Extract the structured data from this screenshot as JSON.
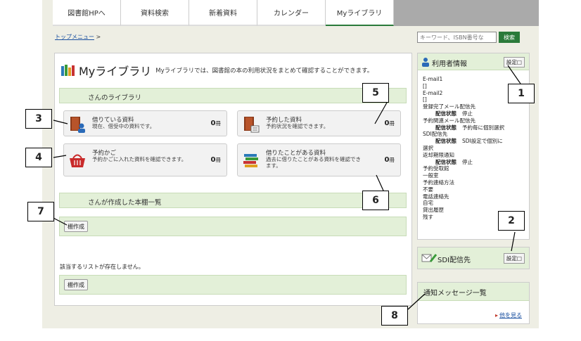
{
  "nav": {
    "tabs": [
      "図書館HPへ",
      "資料検索",
      "新着資料",
      "カレンダー",
      "Myライブラリ"
    ],
    "active_tab": 4
  },
  "breadcrumb": {
    "link": "トップメニュー",
    "separator": ">"
  },
  "search": {
    "placeholder": "キーワード、ISBN番号な",
    "button": "検索"
  },
  "main": {
    "title": "Myライブラリ",
    "description": "Myライブラリでは、図書館の本の利用状況をまとめて確認することができます。",
    "library_header": "さんのライブラリ",
    "cards": [
      {
        "name": "借りている資料",
        "desc": "現在、借受中の資料です。",
        "count": "0",
        "unit": "冊",
        "icon": "borrowed-book-icon"
      },
      {
        "name": "予約した資料",
        "desc": "予約状況を確認できます。",
        "count": "0",
        "unit": "冊",
        "icon": "reserved-book-icon"
      },
      {
        "name": "予約かご",
        "desc": "予約かごに入れた資料を確認できます。",
        "count": "0",
        "unit": "冊",
        "icon": "basket-icon"
      },
      {
        "name": "借りたことがある資料",
        "desc": "過去に借りたことがある資料を確認できます。",
        "count": "0",
        "unit": "冊",
        "icon": "book-stack-icon"
      }
    ],
    "shelf_header": "さんが作成した本棚一覧",
    "create_shelf_button": "棚作成",
    "no_list_text": "該当するリストが存在しません。",
    "create_shelf_button_2": "棚作成"
  },
  "sidebar": {
    "user_info": {
      "title": "利用者情報",
      "settings": "設定",
      "lines": [
        {
          "t": "E-mail1",
          "s": ""
        },
        {
          "t": "[]",
          "s": ""
        },
        {
          "t": "E-mail2",
          "s": ""
        },
        {
          "t": "[]",
          "s": ""
        },
        {
          "t": "登録完了メール配信先",
          "s": ""
        },
        {
          "t": "配信状態",
          "v": "停止",
          "s": "st"
        },
        {
          "t": "予約関連メール配信先",
          "s": ""
        },
        {
          "t": "配信状態",
          "v": "予約毎に個別選択",
          "s": "st"
        },
        {
          "t": "SDI配信先",
          "s": ""
        },
        {
          "t": "配信状態",
          "v": "SDI設定で個別に",
          "s": "st"
        },
        {
          "t": "選択",
          "s": ""
        },
        {
          "t": "返却期限通知",
          "s": ""
        },
        {
          "t": "配信状態",
          "v": "停止",
          "s": "st"
        },
        {
          "t": "予約受取館",
          "s": ""
        },
        {
          "t": "一般室",
          "s": ""
        },
        {
          "t": "予約連絡方法",
          "s": ""
        },
        {
          "t": "不要",
          "s": ""
        },
        {
          "t": "電話連絡先",
          "s": ""
        },
        {
          "t": "自宅",
          "s": ""
        },
        {
          "t": "貸出履歴",
          "s": ""
        },
        {
          "t": "残す",
          "s": ""
        }
      ]
    },
    "sdi": {
      "title": "SDI配信先",
      "settings": "設定"
    },
    "notices": {
      "title": "通知メッセージ一覧",
      "more": "他を見る"
    }
  },
  "callouts": [
    "1",
    "2",
    "3",
    "4",
    "5",
    "6",
    "7",
    "8"
  ]
}
